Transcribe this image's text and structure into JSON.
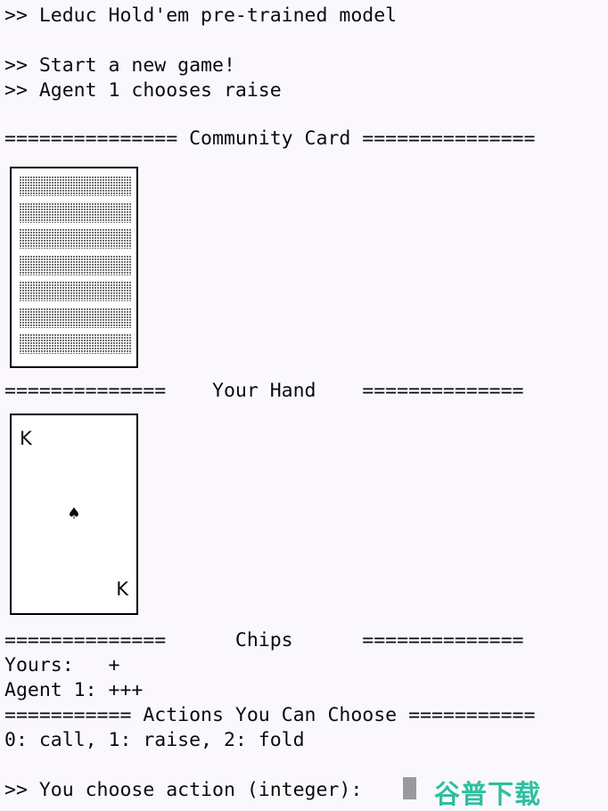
{
  "app": {
    "background_color": "#faf8fc",
    "text_color": "#0b0b0d",
    "title": "Leduc Hold'em pre-trained model"
  },
  "log": {
    "header_line": ">> Leduc Hold'em pre-trained model",
    "start_line": ">> Start a new game!",
    "agent_action_line": ">> Agent 1 chooses raise"
  },
  "sections": {
    "community_card": {
      "separator_left": "===============",
      "label": " Community Card ",
      "separator_right": "==============="
    },
    "your_hand": {
      "separator_left": "==============",
      "label": "    Your Hand    ",
      "separator_right": "=============="
    },
    "chips": {
      "separator_left": "==============",
      "label": "      Chips      ",
      "separator_right": "=============="
    },
    "actions": {
      "separator_left": "===========",
      "label": " Actions You Can Choose ",
      "separator_right": "==========="
    }
  },
  "cards": {
    "community": {
      "face_down": true,
      "back_pattern": "dotted-hatch",
      "row_count": 7
    },
    "hand": {
      "rank": "K",
      "suit_symbol": "♠",
      "suit_name": "spades",
      "face_up": true
    }
  },
  "chips": {
    "yours_label": "Yours:   ",
    "yours_value": "+",
    "agent_label": "Agent 1: ",
    "agent_value": "+++"
  },
  "actions": {
    "options_line": "0: call, 1: raise, 2: fold",
    "option_0": "0: call",
    "option_1": "1: raise",
    "option_2": "2: fold"
  },
  "prompt": {
    "text": ">> You choose action (integer): ",
    "cursor_color": "#9a9a9e",
    "input_value": ""
  },
  "watermark": {
    "text": "谷普下载",
    "color": "#2ebfa0"
  }
}
